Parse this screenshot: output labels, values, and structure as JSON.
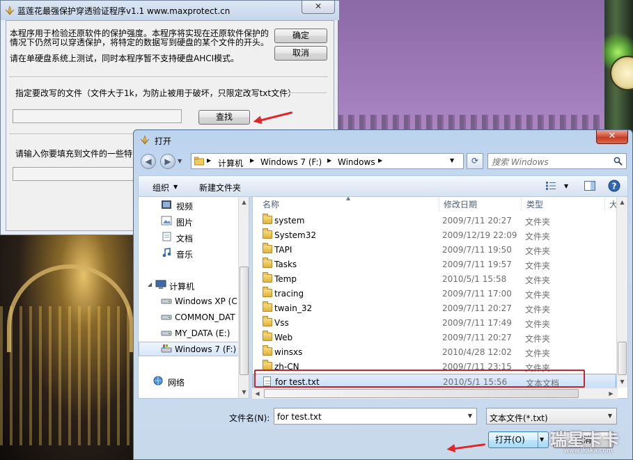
{
  "main_window": {
    "title": "蓝莲花最强保护穿透验证程序v1.1    www.maxprotect.cn",
    "close_label": "✕",
    "description_line1": "本程序用于检验还原软件的保护强度。本程序将实现在还原软件保护的",
    "description_line2": "情况下仍然可以穿透保护，将特定的数据写到硬盘的某个文件的开头。",
    "notice": "请在单硬盘系统上测试，同时本程序暂不支持硬盘AHCI模式。",
    "ok_label": "确定",
    "cancel_label": "取消",
    "group1_label": "指定要改写的文件（文件大于1k，为防止被用于破坏，只限定改写txt文件）",
    "find_label": "查找",
    "group2_label": "请输入你要填充到文件的一些特"
  },
  "open_dialog": {
    "title": "打开",
    "close_label": "✕",
    "breadcrumb": [
      "计算机",
      "Windows 7 (F:)",
      "Windows"
    ],
    "search_placeholder": "搜索 Windows",
    "toolbar": {
      "organize_label": "组织",
      "new_folder_label": "新建文件夹"
    },
    "nav_items": [
      {
        "label": "视频",
        "icon": "video-library-icon"
      },
      {
        "label": "图片",
        "icon": "picture-library-icon"
      },
      {
        "label": "文档",
        "icon": "document-library-icon"
      },
      {
        "label": "音乐",
        "icon": "music-library-icon"
      },
      {
        "label": "计算机",
        "icon": "computer-icon"
      },
      {
        "label": "Windows XP (C",
        "icon": "drive-icon"
      },
      {
        "label": "COMMON_DAT",
        "icon": "drive-icon"
      },
      {
        "label": "MY_DATA (E:)",
        "icon": "drive-icon"
      },
      {
        "label": "Windows 7 (F:)",
        "icon": "system-drive-icon"
      },
      {
        "label": "网络",
        "icon": "network-icon"
      }
    ],
    "columns": {
      "name": "名称",
      "date": "修改日期",
      "type": "类型",
      "size": "大"
    },
    "files": [
      {
        "name": "system",
        "date": "2009/7/11 20:27",
        "type": "文件夹",
        "kind": "folder"
      },
      {
        "name": "System32",
        "date": "2009/12/19 22:09",
        "type": "文件夹",
        "kind": "folder"
      },
      {
        "name": "TAPI",
        "date": "2009/7/11 19:50",
        "type": "文件夹",
        "kind": "folder"
      },
      {
        "name": "Tasks",
        "date": "2009/7/11 19:57",
        "type": "文件夹",
        "kind": "folder"
      },
      {
        "name": "Temp",
        "date": "2010/5/1 15:58",
        "type": "文件夹",
        "kind": "folder"
      },
      {
        "name": "tracing",
        "date": "2009/7/11 17:00",
        "type": "文件夹",
        "kind": "folder"
      },
      {
        "name": "twain_32",
        "date": "2009/7/11 20:27",
        "type": "文件夹",
        "kind": "folder"
      },
      {
        "name": "Vss",
        "date": "2009/7/11 17:49",
        "type": "文件夹",
        "kind": "folder"
      },
      {
        "name": "Web",
        "date": "2009/7/11 20:27",
        "type": "文件夹",
        "kind": "folder"
      },
      {
        "name": "winsxs",
        "date": "2010/4/28 12:02",
        "type": "文件夹",
        "kind": "folder"
      },
      {
        "name": "zh-CN",
        "date": "2009/7/11 23:15",
        "type": "文件夹",
        "kind": "folder"
      },
      {
        "name": "for test.txt",
        "date": "2010/5/1 15:56",
        "type": "文本文档",
        "kind": "text"
      }
    ],
    "filename_label": "文件名(N):",
    "filename_value": "for test.txt",
    "filter_value": "文本文件(*.txt)",
    "open_label": "打开(O)",
    "cancel_label": "取消"
  },
  "watermark": {
    "text": "瑞星卡卡",
    "url": "www.ikaka.com"
  },
  "colors": {
    "annotation_red": "#c0272d",
    "selection_blue": "#cbdff8"
  }
}
